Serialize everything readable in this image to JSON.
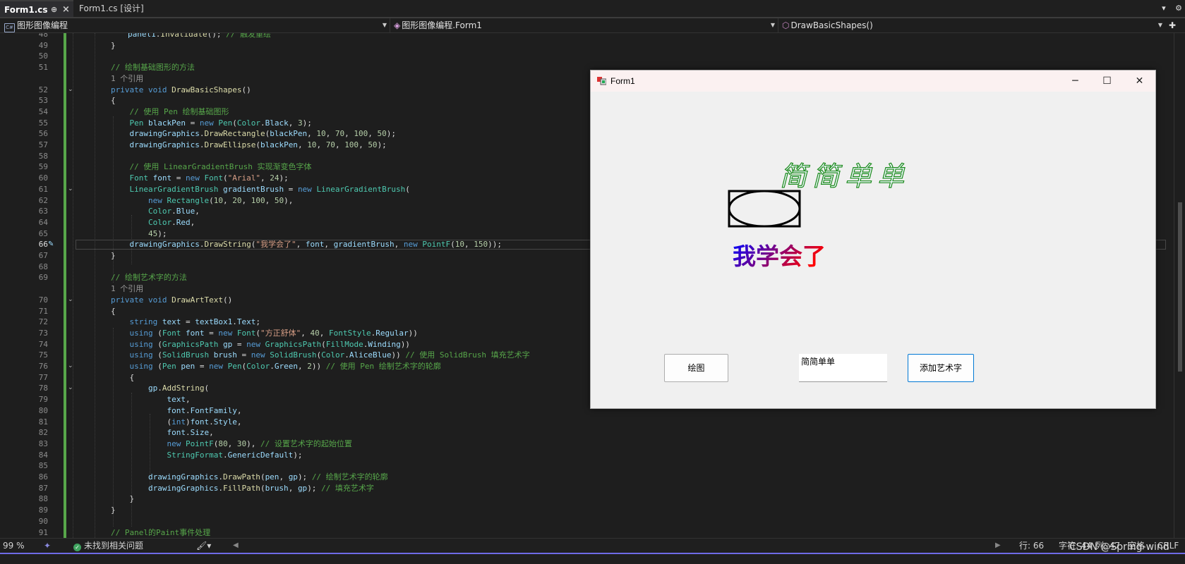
{
  "tabs": [
    {
      "label": "Form1.cs",
      "pin": "⊕",
      "close": "×",
      "active": true
    },
    {
      "label": "Form1.cs [设计]",
      "active": false
    }
  ],
  "nav": {
    "project": "图形图像编程",
    "class": "图形图像编程.Form1",
    "member": "DrawBasicShapes()"
  },
  "code_lines": [
    {
      "n": "48",
      "html": "<span class=\"var\">panel1</span>.<span class=\"fn\">Invalidate</span>(); <span class=\"cm\">// 触发重绘</span>",
      "indent": 1
    },
    {
      "n": "49",
      "html": "}"
    },
    {
      "n": "50",
      "html": ""
    },
    {
      "n": "51",
      "html": "<span class=\"cm\">// 绘制基础图形的方法</span>"
    },
    {
      "n": "",
      "html": "<span class=\"ref\">1 个引用</span>"
    },
    {
      "n": "52",
      "html": "<span class=\"kw\">private</span> <span class=\"kw\">void</span> <span class=\"fn\">DrawBasicShapes</span>()",
      "fold": true
    },
    {
      "n": "53",
      "html": "{"
    },
    {
      "n": "54",
      "html": "    <span class=\"cm\">// 使用 Pen 绘制基础图形</span>"
    },
    {
      "n": "55",
      "html": "    <span class=\"ty\">Pen</span> <span class=\"var\">blackPen</span> = <span class=\"kw\">new</span> <span class=\"ty\">Pen</span>(<span class=\"ty\">Color</span>.<span class=\"var\">Black</span>, <span class=\"nm\">3</span>);"
    },
    {
      "n": "56",
      "html": "    <span class=\"var\">drawingGraphics</span>.<span class=\"fn\">DrawRectangle</span>(<span class=\"var\">blackPen</span>, <span class=\"nm\">10</span>, <span class=\"nm\">70</span>, <span class=\"nm\">100</span>, <span class=\"nm\">50</span>);"
    },
    {
      "n": "57",
      "html": "    <span class=\"var\">drawingGraphics</span>.<span class=\"fn\">DrawEllipse</span>(<span class=\"var\">blackPen</span>, <span class=\"nm\">10</span>, <span class=\"nm\">70</span>, <span class=\"nm\">100</span>, <span class=\"nm\">50</span>);"
    },
    {
      "n": "58",
      "html": ""
    },
    {
      "n": "59",
      "html": "    <span class=\"cm\">// 使用 LinearGradientBrush 实现渐变色字体</span>"
    },
    {
      "n": "60",
      "html": "    <span class=\"ty\">Font</span> <span class=\"var\">font</span> = <span class=\"kw\">new</span> <span class=\"ty\">Font</span>(<span class=\"st\">\"Arial\"</span>, <span class=\"nm\">24</span>);"
    },
    {
      "n": "61",
      "html": "    <span class=\"ty\">LinearGradientBrush</span> <span class=\"var\">gradientBrush</span> = <span class=\"kw\">new</span> <span class=\"ty\">LinearGradientBrush</span>(",
      "fold": true
    },
    {
      "n": "62",
      "html": "        <span class=\"kw\">new</span> <span class=\"ty\">Rectangle</span>(<span class=\"nm\">10</span>, <span class=\"nm\">20</span>, <span class=\"nm\">100</span>, <span class=\"nm\">50</span>),"
    },
    {
      "n": "63",
      "html": "        <span class=\"ty\">Color</span>.<span class=\"var\">Blue</span>,"
    },
    {
      "n": "64",
      "html": "        <span class=\"ty\">Color</span>.<span class=\"var\">Red</span>,"
    },
    {
      "n": "65",
      "html": "        <span class=\"nm\">45</span>);"
    },
    {
      "n": "66",
      "html": "    <span class=\"var\">drawingGraphics</span>.<span class=\"fn\">DrawString</span>(<span class=\"st\">\"我学会了\"</span>, <span class=\"var\">font</span>, <span class=\"var\">gradientBrush</span>, <span class=\"kw\">new</span> <span class=\"ty\">PointF</span>(<span class=\"nm\">10</span>, <span class=\"nm\">150</span>));",
      "current": true
    },
    {
      "n": "67",
      "html": "}"
    },
    {
      "n": "68",
      "html": ""
    },
    {
      "n": "69",
      "html": "<span class=\"cm\">// 绘制艺术字的方法</span>"
    },
    {
      "n": "",
      "html": "<span class=\"ref\">1 个引用</span>"
    },
    {
      "n": "70",
      "html": "<span class=\"kw\">private</span> <span class=\"kw\">void</span> <span class=\"fn\">DrawArtText</span>()",
      "fold": true
    },
    {
      "n": "71",
      "html": "{"
    },
    {
      "n": "72",
      "html": "    <span class=\"kw\">string</span> <span class=\"var\">text</span> = <span class=\"var\">textBox1</span>.<span class=\"var\">Text</span>;"
    },
    {
      "n": "73",
      "html": "    <span class=\"kw\">using</span> (<span class=\"ty\">Font</span> <span class=\"var\">font</span> = <span class=\"kw\">new</span> <span class=\"ty\">Font</span>(<span class=\"st\">\"方正舒体\"</span>, <span class=\"nm\">40</span>, <span class=\"ty\">FontStyle</span>.<span class=\"var\">Regular</span>))"
    },
    {
      "n": "74",
      "html": "    <span class=\"kw\">using</span> (<span class=\"ty\">GraphicsPath</span> <span class=\"var\">gp</span> = <span class=\"kw\">new</span> <span class=\"ty\">GraphicsPath</span>(<span class=\"ty\">FillMode</span>.<span class=\"var\">Winding</span>))"
    },
    {
      "n": "75",
      "html": "    <span class=\"kw\">using</span> (<span class=\"ty\">SolidBrush</span> <span class=\"var\">brush</span> = <span class=\"kw\">new</span> <span class=\"ty\">SolidBrush</span>(<span class=\"ty\">Color</span>.<span class=\"var\">AliceBlue</span>)) <span class=\"cm\">// 使用 SolidBrush 填充艺术字</span>"
    },
    {
      "n": "76",
      "html": "    <span class=\"kw\">using</span> (<span class=\"ty\">Pen</span> <span class=\"var\">pen</span> = <span class=\"kw\">new</span> <span class=\"ty\">Pen</span>(<span class=\"ty\">Color</span>.<span class=\"var\">Green</span>, <span class=\"nm\">2</span>)) <span class=\"cm\">// 使用 Pen 绘制艺术字的轮廓</span>",
      "fold": true
    },
    {
      "n": "77",
      "html": "    {"
    },
    {
      "n": "78",
      "html": "        <span class=\"var\">gp</span>.<span class=\"fn\">AddString</span>(",
      "fold": true
    },
    {
      "n": "79",
      "html": "            <span class=\"var\">text</span>,"
    },
    {
      "n": "80",
      "html": "            <span class=\"var\">font</span>.<span class=\"var\">FontFamily</span>,"
    },
    {
      "n": "81",
      "html": "            (<span class=\"kw\">int</span>)<span class=\"var\">font</span>.<span class=\"var\">Style</span>,"
    },
    {
      "n": "82",
      "html": "            <span class=\"var\">font</span>.<span class=\"var\">Size</span>,"
    },
    {
      "n": "83",
      "html": "            <span class=\"kw\">new</span> <span class=\"ty\">PointF</span>(<span class=\"nm\">80</span>, <span class=\"nm\">30</span>), <span class=\"cm\">// 设置艺术字的起始位置</span>"
    },
    {
      "n": "84",
      "html": "            <span class=\"ty\">StringFormat</span>.<span class=\"var\">GenericDefault</span>);"
    },
    {
      "n": "85",
      "html": ""
    },
    {
      "n": "86",
      "html": "        <span class=\"var\">drawingGraphics</span>.<span class=\"fn\">DrawPath</span>(<span class=\"var\">pen</span>, <span class=\"var\">gp</span>); <span class=\"cm\">// 绘制艺术字的轮廓</span>"
    },
    {
      "n": "87",
      "html": "        <span class=\"var\">drawingGraphics</span>.<span class=\"fn\">FillPath</span>(<span class=\"var\">brush</span>, <span class=\"var\">gp</span>); <span class=\"cm\">// 填充艺术字</span>"
    },
    {
      "n": "88",
      "html": "    }"
    },
    {
      "n": "89",
      "html": "}"
    },
    {
      "n": "90",
      "html": ""
    },
    {
      "n": "91",
      "html": "<span class=\"cm\">// Panel的Paint事件处理</span>"
    }
  ],
  "status": {
    "zoom": "99 %",
    "issues": "未找到相关问题",
    "line": "行: 66",
    "char": "字符: 44",
    "col": "列: 47",
    "spaces": "空格",
    "eol": "CRLF"
  },
  "form": {
    "title": "Form1",
    "minimize": "─",
    "maximize": "☐",
    "close": "✕",
    "art_text": "简简单单",
    "gradient_text": "我学会了",
    "draw_button": "绘图",
    "textbox_value": "简简单单",
    "add_button": "添加艺术字"
  },
  "watermark": "CSDN @Spring-wind",
  "colors": {
    "accent": "#0078d4",
    "editor_bg": "#1e1e1e",
    "change_bar": "#57a64a",
    "art_outline": "#1a8a1a",
    "gradient_start": "#0000ff",
    "gradient_end": "#ff0000"
  }
}
